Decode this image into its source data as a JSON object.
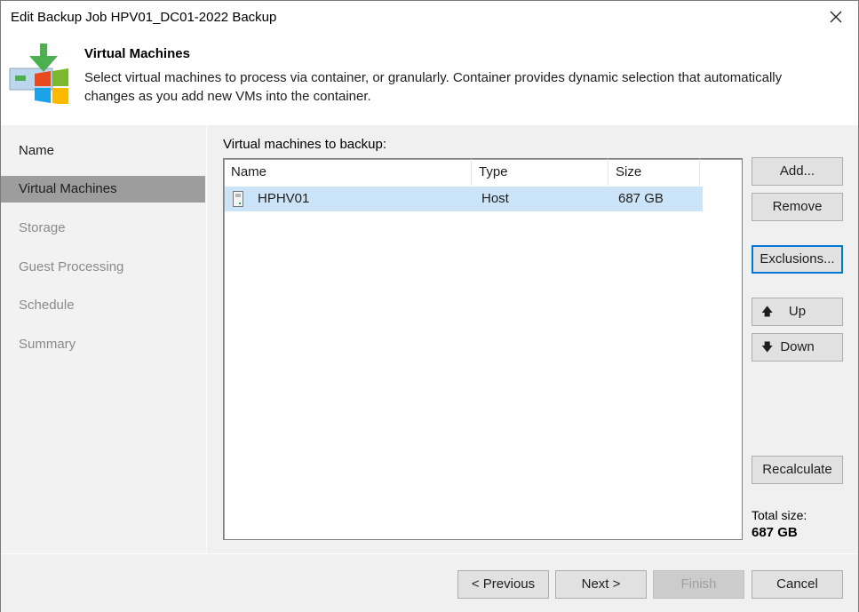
{
  "window": {
    "title": "Edit Backup Job HPV01_DC01-2022 Backup",
    "close_icon": "close-icon"
  },
  "header": {
    "title": "Virtual Machines",
    "description": "Select virtual machines to process via container, or granularly. Container provides dynamic selection that automatically changes as you add new VMs into the container.",
    "icon": "backup-windows-icon"
  },
  "nav": {
    "items": [
      {
        "label": "Name",
        "state": "done"
      },
      {
        "label": "Virtual Machines",
        "state": "active"
      },
      {
        "label": "Storage",
        "state": "pending"
      },
      {
        "label": "Guest Processing",
        "state": "pending"
      },
      {
        "label": "Schedule",
        "state": "pending"
      },
      {
        "label": "Summary",
        "state": "pending"
      }
    ]
  },
  "main": {
    "list_label": "Virtual machines to backup:",
    "columns": [
      "Name",
      "Type",
      "Size"
    ],
    "rows": [
      {
        "icon": "host-server-icon",
        "name": "HPHV01",
        "type": "Host",
        "size": "687 GB",
        "selected": true
      }
    ]
  },
  "side_buttons": {
    "add": "Add...",
    "remove": "Remove",
    "exclusions": "Exclusions...",
    "up": "Up",
    "down": "Down",
    "recalculate": "Recalculate"
  },
  "total": {
    "label": "Total size:",
    "value": "687 GB"
  },
  "footer": {
    "previous": "< Previous",
    "next": "Next >",
    "finish": "Finish",
    "cancel": "Cancel"
  }
}
